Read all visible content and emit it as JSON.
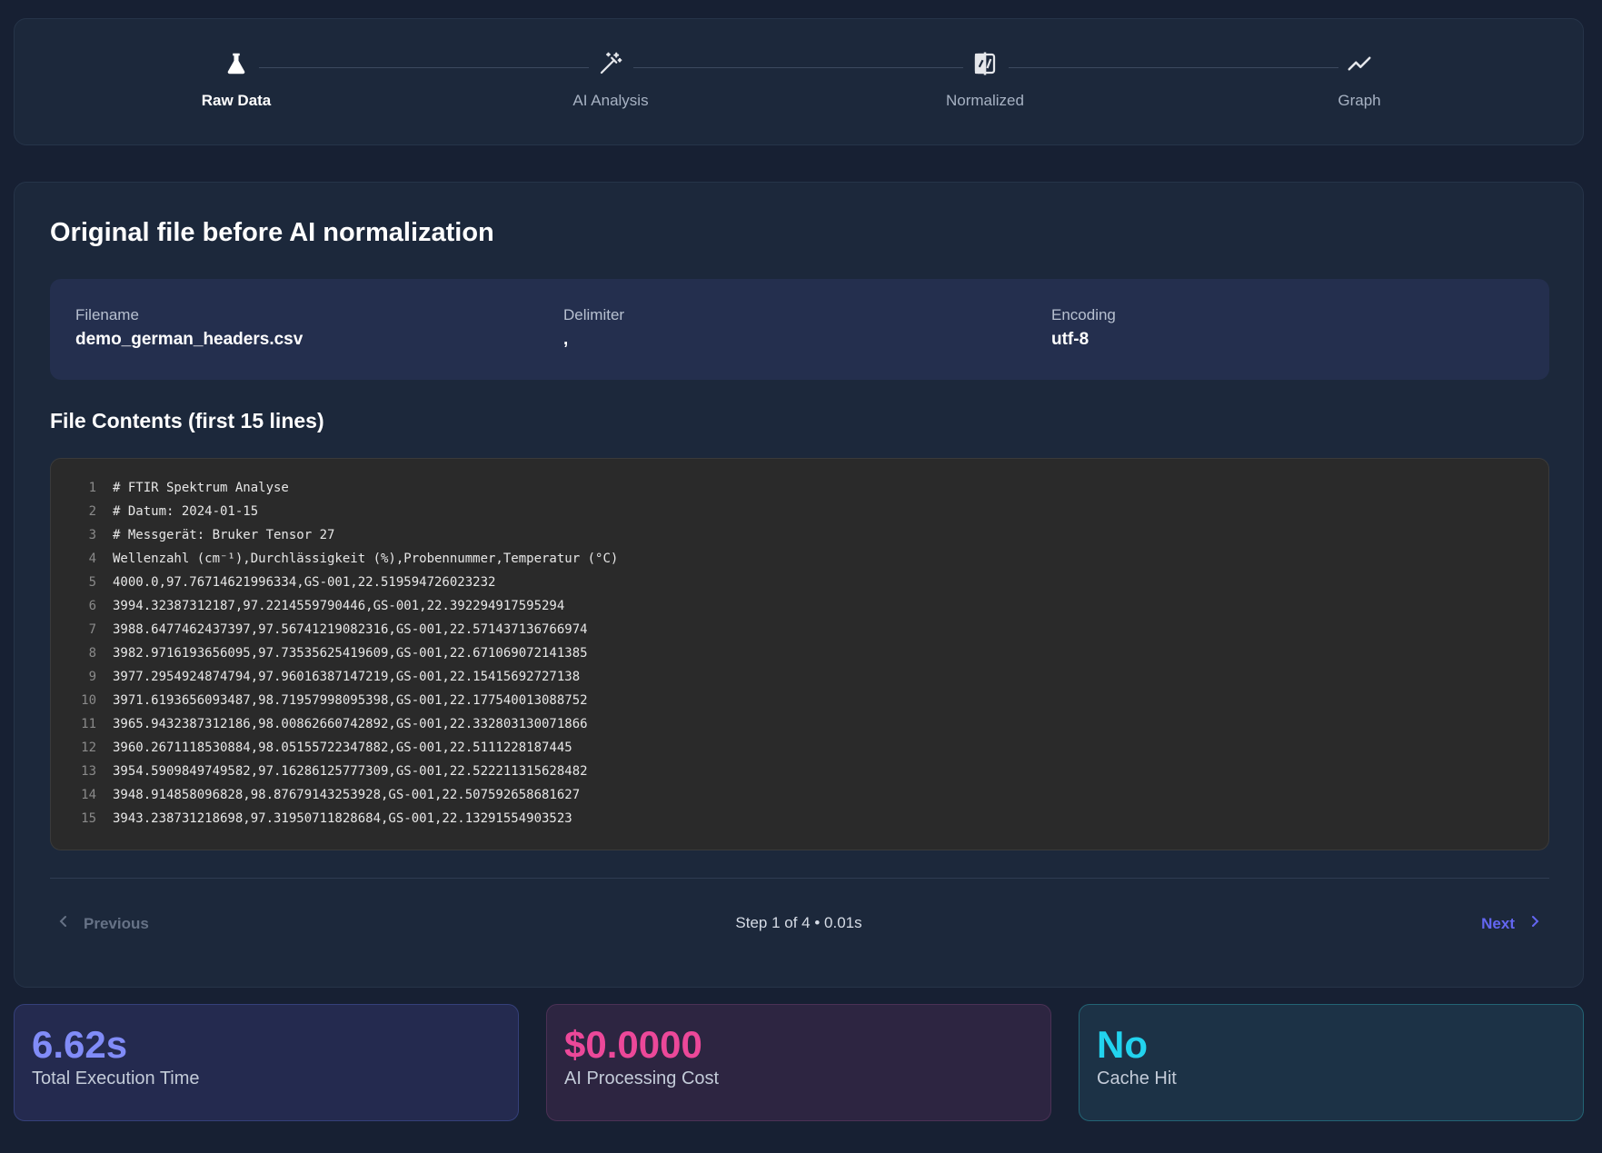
{
  "stepper": {
    "steps": [
      {
        "label": "Raw Data",
        "icon": "flask-icon",
        "active": true
      },
      {
        "label": "AI Analysis",
        "icon": "magic-wand-icon",
        "active": false
      },
      {
        "label": "Normalized",
        "icon": "compare-icon",
        "active": false
      },
      {
        "label": "Graph",
        "icon": "trend-line-icon",
        "active": false
      }
    ]
  },
  "card": {
    "title": "Original file before AI normalization",
    "meta": {
      "filename_label": "Filename",
      "filename": "demo_german_headers.csv",
      "delimiter_label": "Delimiter",
      "delimiter": ",",
      "encoding_label": "Encoding",
      "encoding": "utf-8"
    },
    "contents_heading": "File Contents (first 15 lines)",
    "lines": [
      {
        "n": "1",
        "text": "# FTIR Spektrum Analyse"
      },
      {
        "n": "2",
        "text": "# Datum: 2024-01-15"
      },
      {
        "n": "3",
        "text": "# Messgerät: Bruker Tensor 27"
      },
      {
        "n": "4",
        "text": "Wellenzahl (cm⁻¹),Durchlässigkeit (%),Probennummer,Temperatur (°C)"
      },
      {
        "n": "5",
        "text": "4000.0,97.76714621996334,GS-001,22.519594726023232"
      },
      {
        "n": "6",
        "text": "3994.32387312187,97.2214559790446,GS-001,22.392294917595294"
      },
      {
        "n": "7",
        "text": "3988.6477462437397,97.56741219082316,GS-001,22.571437136766974"
      },
      {
        "n": "8",
        "text": "3982.9716193656095,97.73535625419609,GS-001,22.671069072141385"
      },
      {
        "n": "9",
        "text": "3977.2954924874794,97.96016387147219,GS-001,22.15415692727138"
      },
      {
        "n": "10",
        "text": "3971.6193656093487,98.71957998095398,GS-001,22.177540013088752"
      },
      {
        "n": "11",
        "text": "3965.9432387312186,98.00862660742892,GS-001,22.332803130071866"
      },
      {
        "n": "12",
        "text": "3960.2671118530884,98.05155722347882,GS-001,22.5111228187445"
      },
      {
        "n": "13",
        "text": "3954.5909849749582,97.16286125777309,GS-001,22.522211315628482"
      },
      {
        "n": "14",
        "text": "3948.914858096828,98.87679143253928,GS-001,22.507592658681627"
      },
      {
        "n": "15",
        "text": "3943.238731218698,97.31950711828684,GS-001,22.13291554903523"
      }
    ],
    "nav": {
      "previous_label": "Previous",
      "next_label": "Next",
      "step_info": "Step 1 of 4 • 0.01s"
    }
  },
  "stats": {
    "execution_time": {
      "value": "6.62s",
      "label": "Total Execution Time"
    },
    "cost": {
      "value": "$0.0000",
      "label": "AI Processing Cost"
    },
    "cache": {
      "value": "No",
      "label": "Cache Hit"
    }
  },
  "colors": {
    "accent": "#6366f1",
    "stat_time": "#818cf8",
    "stat_cost": "#ec4899",
    "stat_cache": "#22d3ee"
  }
}
